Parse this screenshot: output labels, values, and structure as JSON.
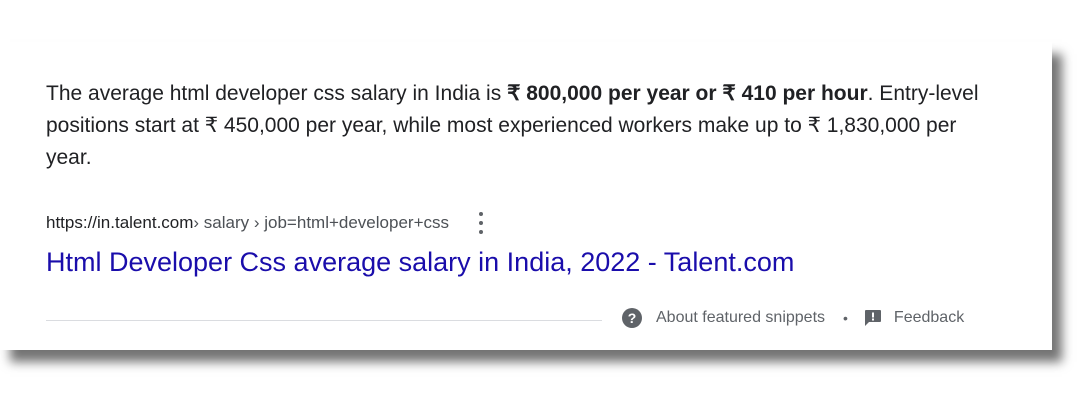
{
  "snippet": {
    "text_before": "The average html developer css salary in India is ",
    "bold_text": "₹ 800,000 per year or ₹ 410 per hour",
    "text_after": ". Entry-level positions start at ₹ 450,000 per year, while most experienced workers make up to ₹ 1,830,000 per year."
  },
  "source": {
    "domain": "https://in.talent.com",
    "path": " › salary › job=html+developer+css",
    "more_options_icon": "three-dots-vertical-icon"
  },
  "result": {
    "title": "Html Developer Css average salary in India, 2022 - Talent.com",
    "link_color": "#1a0dab"
  },
  "footer": {
    "about_label": "About featured snippets",
    "separator": "•",
    "feedback_label": "Feedback",
    "about_icon": "help-circle-icon",
    "feedback_icon": "feedback-icon"
  }
}
